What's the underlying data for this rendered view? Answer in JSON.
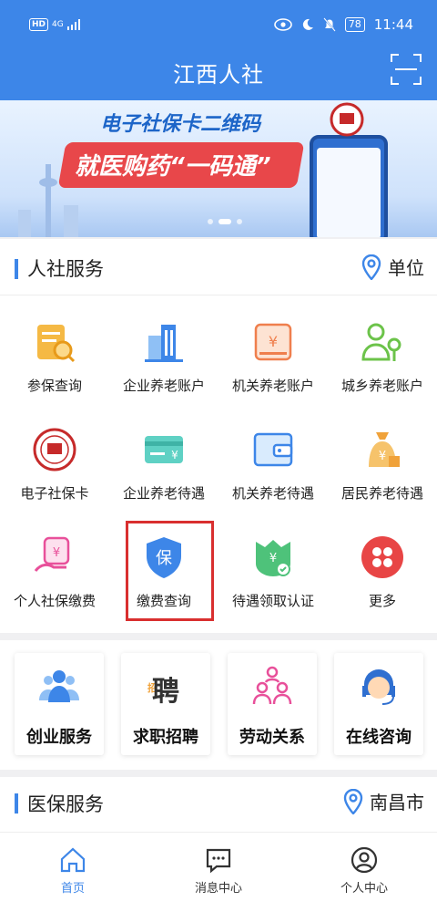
{
  "status_bar": {
    "hd": "HD",
    "signal": "4G",
    "battery": "78",
    "time": "11:44"
  },
  "header": {
    "title": "江西人社"
  },
  "banner": {
    "line1": "电子社保卡二维码",
    "line2": "就医购药“一码通”"
  },
  "hr_services": {
    "title": "人社服务",
    "location": "单位",
    "items": [
      {
        "label": "参保查询",
        "icon": "insurance-query-icon"
      },
      {
        "label": "企业养老账户",
        "icon": "enterprise-pension-account-icon"
      },
      {
        "label": "机关养老账户",
        "icon": "agency-pension-account-icon"
      },
      {
        "label": "城乡养老账户",
        "icon": "urban-rural-pension-account-icon"
      },
      {
        "label": "电子社保卡",
        "icon": "social-security-card-icon"
      },
      {
        "label": "企业养老待遇",
        "icon": "enterprise-pension-benefit-icon"
      },
      {
        "label": "机关养老待遇",
        "icon": "agency-pension-benefit-icon"
      },
      {
        "label": "居民养老待遇",
        "icon": "resident-pension-benefit-icon"
      },
      {
        "label": "个人社保缴费",
        "icon": "personal-payment-icon"
      },
      {
        "label": "缴费查询",
        "icon": "payment-query-shield-icon"
      },
      {
        "label": "待遇领取认证",
        "icon": "benefit-certification-icon"
      },
      {
        "label": "更多",
        "icon": "more-icon"
      }
    ]
  },
  "quick_services": [
    {
      "label": "创业服务",
      "icon": "entrepreneurship-icon"
    },
    {
      "label": "求职招聘",
      "icon": "recruitment-icon"
    },
    {
      "label": "劳动关系",
      "icon": "labor-relations-icon"
    },
    {
      "label": "在线咨询",
      "icon": "online-consult-icon"
    }
  ],
  "medical_services": {
    "title": "医保服务",
    "location": "南昌市"
  },
  "tabbar": [
    {
      "label": "首页",
      "icon": "home-icon"
    },
    {
      "label": "消息中心",
      "icon": "message-icon"
    },
    {
      "label": "个人中心",
      "icon": "profile-icon"
    }
  ],
  "colors": {
    "primary": "#3d86e8",
    "highlight": "#d92f2f"
  }
}
